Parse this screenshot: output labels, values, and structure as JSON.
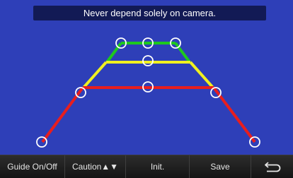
{
  "banner": {
    "text": "Never depend solely on camera."
  },
  "toolbar": {
    "guide_label": "Guide On/Off",
    "caution_label": "Caution▲▼",
    "init_label": "Init.",
    "save_label": "Save",
    "back_icon": "return-arrow-icon"
  },
  "guide_colors": {
    "near": "#e81e1e",
    "middle": "#f0f020",
    "far": "#1ec81e",
    "background": "#2e3fb8",
    "handle": "#ffffff"
  }
}
